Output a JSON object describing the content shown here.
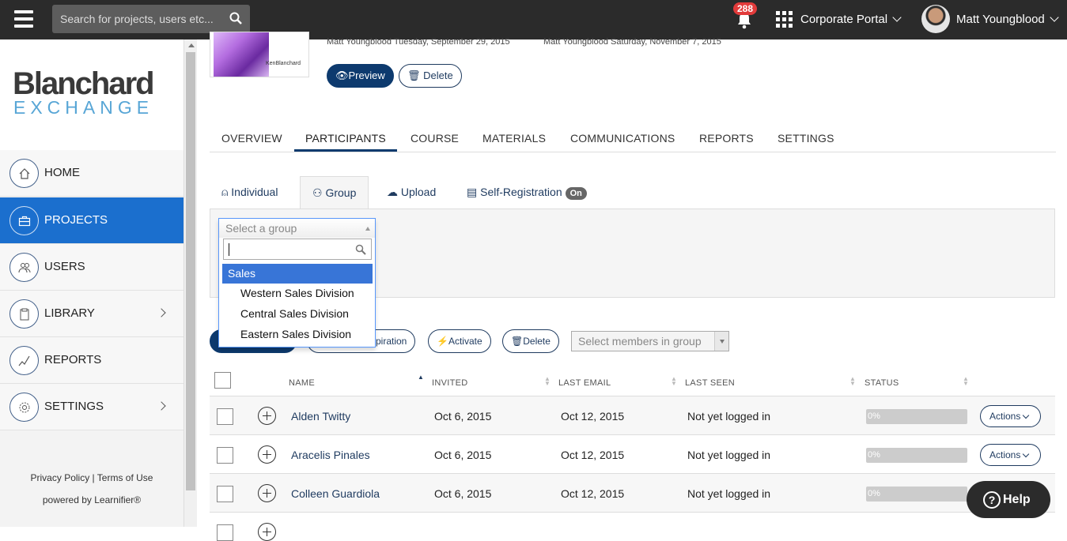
{
  "topbar": {
    "search_placeholder": "Search for projects, users etc...",
    "notification_count": "288",
    "portal_label": "Corporate Portal",
    "user_name": "Matt Youngblood"
  },
  "sidebar": {
    "logo_main": "Blanchard",
    "logo_sub": "EXCHANGE",
    "items": [
      {
        "label": "HOME",
        "icon": "home-icon"
      },
      {
        "label": "PROJECTS",
        "icon": "briefcase-icon"
      },
      {
        "label": "USERS",
        "icon": "users-icon"
      },
      {
        "label": "LIBRARY",
        "icon": "document-icon"
      },
      {
        "label": "REPORTS",
        "icon": "chart-line-icon"
      },
      {
        "label": "SETTINGS",
        "icon": "gear-icon"
      }
    ],
    "footer_privacy": "Privacy Policy",
    "footer_sep": " | ",
    "footer_terms": "Terms of Use",
    "powered_by": "powered by Learnifier®"
  },
  "project": {
    "thumb_text": "KenBlanchard",
    "created_meta": "Matt Youngblood Tuesday, September 29, 2015",
    "modified_meta": "Matt Youngblood Saturday, November 7, 2015",
    "preview_label": "Preview",
    "delete_label": "Delete"
  },
  "tabs": [
    "OVERVIEW",
    "PARTICIPANTS",
    "COURSE",
    "MATERIALS",
    "COMMUNICATIONS",
    "REPORTS",
    "SETTINGS"
  ],
  "subtabs": {
    "individual": "Individual",
    "group": "Group",
    "upload": "Upload",
    "self_registration": "Self-Registration",
    "self_registration_state": "On"
  },
  "group_select": {
    "placeholder": "Select a group",
    "group_header": "Sales",
    "options": [
      "Western Sales Division",
      "Central Sales Division",
      "Eastern Sales Division"
    ]
  },
  "bulk_actions": {
    "expiration": "piration",
    "activate": "Activate",
    "delete": "Delete",
    "members_placeholder": "Select members in group"
  },
  "table": {
    "headers": [
      "NAME",
      "INVITED",
      "LAST EMAIL",
      "LAST SEEN",
      "STATUS"
    ],
    "rows": [
      {
        "name": "Alden Twitty",
        "invited": "Oct 6, 2015",
        "last_email": "Oct 12, 2015",
        "last_seen": "Not yet logged in",
        "status": "0%",
        "actions": "Actions"
      },
      {
        "name": "Aracelis Pinales",
        "invited": "Oct 6, 2015",
        "last_email": "Oct 12, 2015",
        "last_seen": "Not yet logged in",
        "status": "0%",
        "actions": "Actions"
      },
      {
        "name": "Colleen Guardiola",
        "invited": "Oct 6, 2015",
        "last_email": "Oct 12, 2015",
        "last_seen": "Not yet logged in",
        "status": "0%",
        "actions": "Actions"
      }
    ]
  },
  "help_label": "Help",
  "colors": {
    "topbar": "#2b2b2b",
    "nav_active": "#1b6fce",
    "primary": "#0d3a6e",
    "option_highlight": "#3875d7"
  }
}
